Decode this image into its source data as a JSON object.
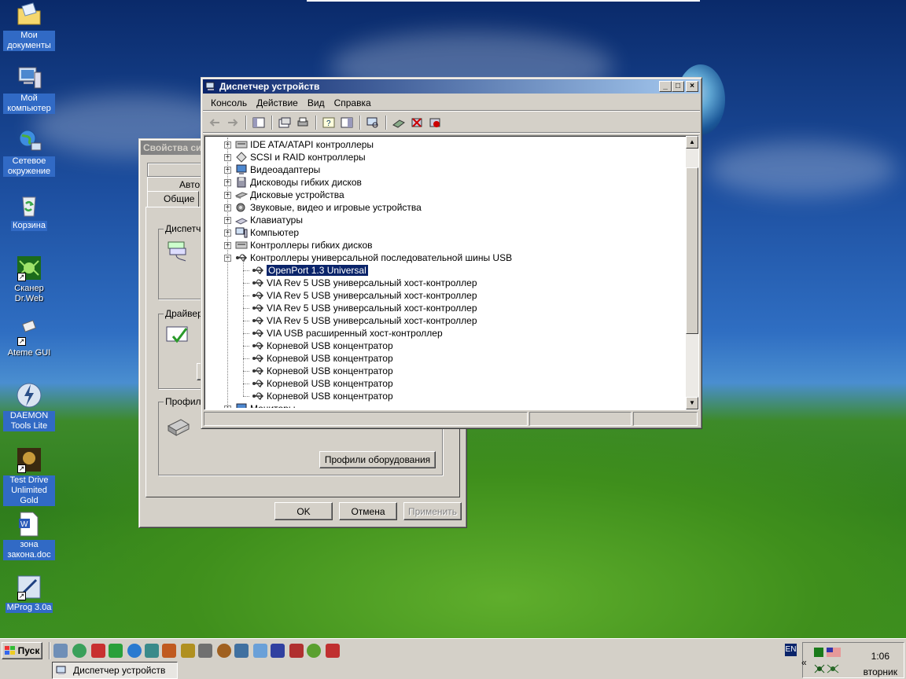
{
  "desktop": {
    "icons": [
      {
        "label": "Мои документы"
      },
      {
        "label": "Мой компьютер"
      },
      {
        "label": "Сетевое окружение"
      },
      {
        "label": "Корзина"
      },
      {
        "label": "Сканер Dr.Web"
      },
      {
        "label": "Ateme GUI"
      },
      {
        "label": "DAEMON Tools Lite"
      },
      {
        "label": "Test Drive Unlimited Gold"
      },
      {
        "label": "зона закона.doc"
      },
      {
        "label": "MProg 3.0a"
      }
    ]
  },
  "sysprops": {
    "title": "Свойства сис",
    "tabs": [
      "Автом",
      "Общие"
    ],
    "groups": [
      "Диспетч",
      "Драйвер",
      "Профили"
    ],
    "profiles_text": "...",
    "profiles_button": "Профили оборудования",
    "ok": "OK",
    "cancel": "Отмена",
    "apply": "Применить"
  },
  "devmgr": {
    "title": "Диспетчер устройств",
    "menu": [
      "Консоль",
      "Действие",
      "Вид",
      "Справка"
    ],
    "tree": [
      {
        "label": "IDE ATA/ATAPI контроллеры",
        "level": 0,
        "expander": "+",
        "icon": "ide-controller-icon"
      },
      {
        "label": "SCSI и RAID контроллеры",
        "level": 0,
        "expander": "+",
        "icon": "scsi-controller-icon"
      },
      {
        "label": "Видеоадаптеры",
        "level": 0,
        "expander": "+",
        "icon": "display-adapter-icon"
      },
      {
        "label": "Дисководы гибких дисков",
        "level": 0,
        "expander": "+",
        "icon": "floppy-drive-icon"
      },
      {
        "label": "Дисковые устройства",
        "level": 0,
        "expander": "+",
        "icon": "disk-drive-icon"
      },
      {
        "label": "Звуковые, видео и игровые устройства",
        "level": 0,
        "expander": "+",
        "icon": "sound-device-icon"
      },
      {
        "label": "Клавиатуры",
        "level": 0,
        "expander": "+",
        "icon": "keyboard-icon"
      },
      {
        "label": "Компьютер",
        "level": 0,
        "expander": "+",
        "icon": "computer-icon"
      },
      {
        "label": "Контроллеры гибких дисков",
        "level": 0,
        "expander": "+",
        "icon": "floppy-controller-icon"
      },
      {
        "label": "Контроллеры универсальной последовательной шины USB",
        "level": 0,
        "expander": "-",
        "icon": "usb-icon"
      },
      {
        "label": "OpenPort 1.3 Universal",
        "level": 1,
        "selected": true,
        "icon": "usb-icon"
      },
      {
        "label": "VIA Rev 5 USB универсальный хост-контроллер",
        "level": 1,
        "icon": "usb-icon"
      },
      {
        "label": "VIA Rev 5 USB универсальный хост-контроллер",
        "level": 1,
        "icon": "usb-icon"
      },
      {
        "label": "VIA Rev 5 USB универсальный хост-контроллер",
        "level": 1,
        "icon": "usb-icon"
      },
      {
        "label": "VIA Rev 5 USB универсальный хост-контроллер",
        "level": 1,
        "icon": "usb-icon"
      },
      {
        "label": "VIA USB расширенный хост-контроллер",
        "level": 1,
        "icon": "usb-icon"
      },
      {
        "label": "Корневой USB концентратор",
        "level": 1,
        "icon": "usb-icon"
      },
      {
        "label": "Корневой USB концентратор",
        "level": 1,
        "icon": "usb-icon"
      },
      {
        "label": "Корневой USB концентратор",
        "level": 1,
        "icon": "usb-icon"
      },
      {
        "label": "Корневой USB концентратор",
        "level": 1,
        "icon": "usb-icon"
      },
      {
        "label": "Корневой USB концентратор",
        "level": 1,
        "icon": "usb-icon"
      },
      {
        "label": "Мониторы",
        "level": 0,
        "expander": "+",
        "icon": "monitor-icon"
      }
    ]
  },
  "taskbar": {
    "start_label": "Пуск",
    "task_label": "Диспетчер устройств",
    "lang": "EN",
    "time": "1:06",
    "day": "вторник"
  },
  "colors": {
    "selection": "#0a246a",
    "title_active": "#0a246a",
    "face": "#d4d0c8"
  }
}
